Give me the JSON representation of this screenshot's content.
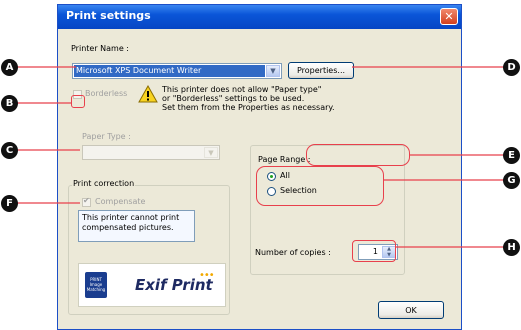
{
  "window": {
    "title": "Print settings",
    "close_glyph": "✕"
  },
  "printer": {
    "label": "Printer Name :",
    "value": "Microsoft XPS Document Writer",
    "properties_label": "Properties..."
  },
  "borderless": {
    "label": "Borderless",
    "checked": false
  },
  "warning": {
    "icon": "warning-icon",
    "text": [
      "This printer does not allow \"Paper type\"",
      "or \"Borderless\" settings to be used.",
      "Set them from the Properties as necessary."
    ]
  },
  "paper_type": {
    "label": "Paper Type :",
    "value": ""
  },
  "correction": {
    "group_label": "Print correction",
    "compensate_label": "Compensate",
    "compensate_checked": true,
    "message": [
      "This printer cannot print",
      "compensated pictures."
    ]
  },
  "logos": {
    "photo_logo_text": [
      "PRINT",
      "Image",
      "Matching"
    ],
    "exif_label": "Exif Print"
  },
  "page_range": {
    "label": "Page Range :",
    "options": [
      "All",
      "Selection"
    ],
    "selected": "All"
  },
  "copies": {
    "label": "Number of copies :",
    "value": "1"
  },
  "ok_label": "OK",
  "callouts": [
    "A",
    "B",
    "C",
    "D",
    "E",
    "F",
    "G",
    "H"
  ],
  "colors": {
    "title_bar": "#0a55d8",
    "dialog_bg": "#ece9d8",
    "callout_line": "#e8404c",
    "selection": "#316ac5"
  }
}
